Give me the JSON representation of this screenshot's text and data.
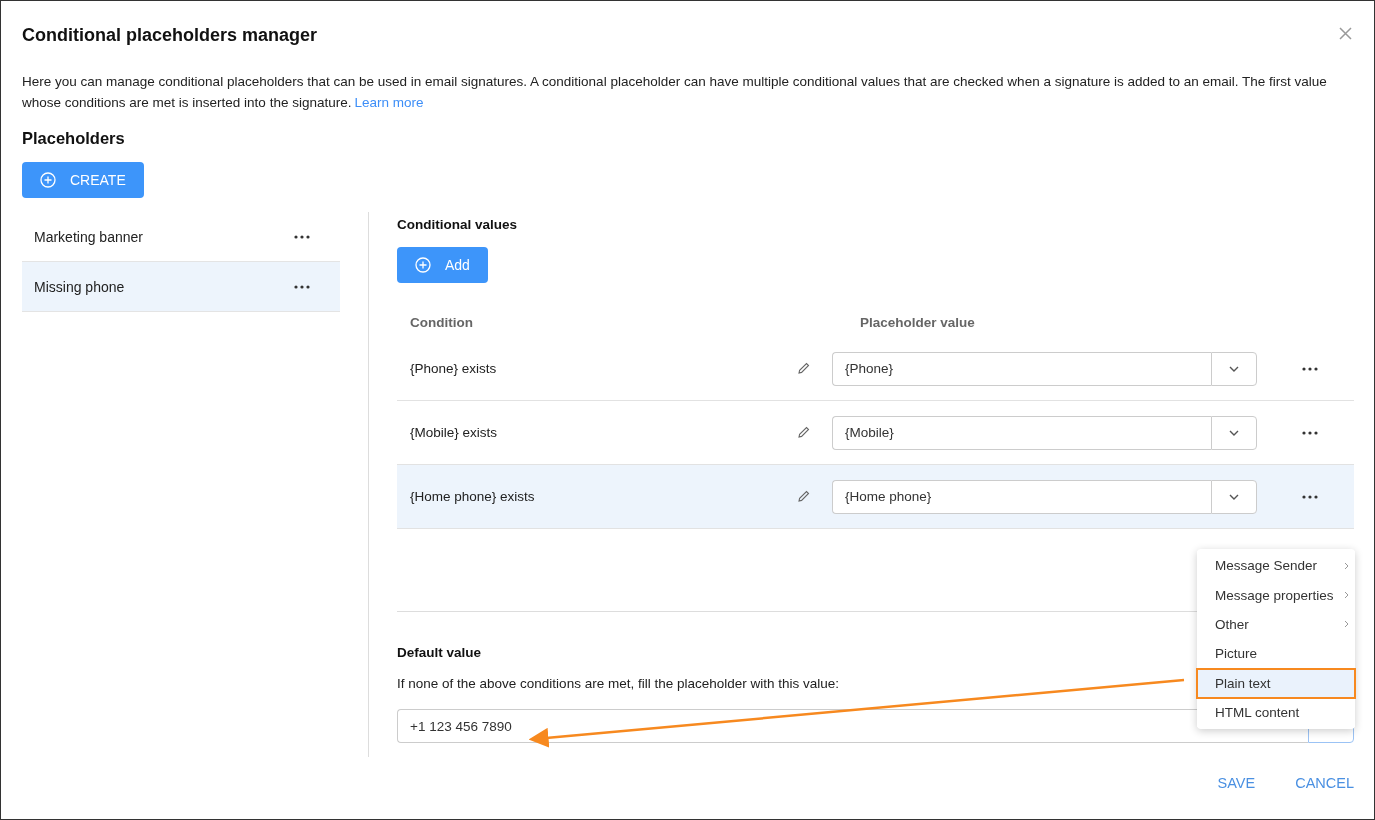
{
  "dialog": {
    "title": "Conditional placeholders manager",
    "description": "Here you can manage conditional placeholders that can be used in email signatures. A conditional placeholder can have multiple conditional values that are checked when a signature is added to an email. The first value whose conditions are met is inserted into the signature.",
    "learn_more": "Learn more"
  },
  "placeholders": {
    "heading": "Placeholders",
    "create_button": "CREATE",
    "items": [
      {
        "label": "Marketing banner",
        "selected": false
      },
      {
        "label": "Missing phone",
        "selected": true
      }
    ]
  },
  "conditional_values": {
    "heading": "Conditional values",
    "add_button": "Add",
    "columns": [
      "Condition",
      "Placeholder value"
    ],
    "rows": [
      {
        "condition": "{Phone} exists",
        "value": "{Phone}",
        "selected": false
      },
      {
        "condition": "{Mobile} exists",
        "value": "{Mobile}",
        "selected": false
      },
      {
        "condition": "{Home phone} exists",
        "value": "{Home phone}",
        "selected": true
      }
    ]
  },
  "default_value": {
    "heading": "Default value",
    "hint": "If none of the above conditions are met, fill the placeholder with this value:",
    "value": "+1 123 456 7890"
  },
  "menu": {
    "items": [
      {
        "label": "Message Sender",
        "kind": "submenu",
        "selected": false
      },
      {
        "label": "Message properties",
        "kind": "submenu",
        "selected": false
      },
      {
        "label": "Other",
        "kind": "submenu",
        "selected": false
      },
      {
        "label": "Picture",
        "kind": "plain",
        "selected": false
      },
      {
        "label": "Plain text",
        "kind": "plain",
        "selected": true
      },
      {
        "label": "HTML content",
        "kind": "plain",
        "selected": false
      }
    ]
  },
  "footer": {
    "buttons": [
      "SAVE",
      "CANCEL"
    ]
  }
}
